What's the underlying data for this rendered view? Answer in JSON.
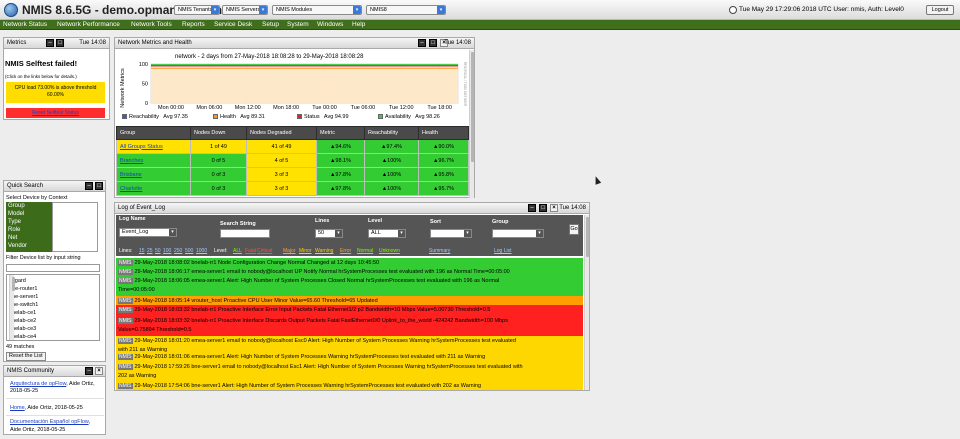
{
  "header": {
    "app_title": "NMIS 8.6.5G - demo.opmantek.com",
    "dropdowns": [
      "NMIS Tenants",
      "NMIS Servers",
      "NMIS Modules",
      "NMIS8"
    ],
    "datetime_user": "Tue May 29 17:29:06 2018 UTC  User: nmis, Auth: Level0",
    "logout": "Logout"
  },
  "menu": [
    "Network Status",
    "Network Performance",
    "Network Tools",
    "Reports",
    "Service Desk",
    "Setup",
    "System",
    "Windows",
    "Help"
  ],
  "metrics_win": {
    "title": "Metrics",
    "time": "Tue 14:08",
    "selftest_title": "NMIS Selftest failed!",
    "click_note": "(Click on the links below for details.)",
    "cpu_line1": "CPU load 73.00% is above threshold",
    "cpu_line2": "60.00%",
    "reset_link": "Reset Selftest Status"
  },
  "health_win": {
    "title": "Network Metrics and Health",
    "time": "Tue 14:08",
    "chart_title": "network - 2 days from 27-May-2018 18:08:28 to 29-May-2018 18:08:28",
    "legend": [
      {
        "name": "Reachability",
        "avg": "Avg 97.35"
      },
      {
        "name": "Health",
        "avg": "Avg 89.31"
      },
      {
        "name": "Status",
        "avg": "Avg 94.99"
      },
      {
        "name": "Availability",
        "avg": "Avg 98.26"
      }
    ],
    "table": {
      "headers": [
        "Group",
        "Nodes Down",
        "Nodes Degraded",
        "Metric",
        "Reachability",
        "Health"
      ],
      "rows": [
        [
          "All Groups Status",
          "1 of 49",
          "41 of 49",
          "▲94.6%",
          "▲97.4%",
          "▲90.0%"
        ],
        [
          "Branches",
          "0 of 5",
          "4 of 5",
          "▲98.1%",
          "▲100%",
          "▲96.7%"
        ],
        [
          "Brisbane",
          "0 of 3",
          "3 of 3",
          "▲97.8%",
          "▲100%",
          "▲95.8%"
        ],
        [
          "Charlotte",
          "0 of 3",
          "3 of 3",
          "▲97.8%",
          "▲100%",
          "▲95.7%"
        ]
      ]
    }
  },
  "chart_data": {
    "type": "area",
    "title": "network - 2 days from 27-May-2018 18:08:28 to 29-May-2018 18:08:28",
    "ylabel": "Network Metrics",
    "ylim": [
      0,
      100
    ],
    "yticks": [
      "100",
      "50",
      "0"
    ],
    "xticks": [
      "Mon 00:00",
      "Mon 06:00",
      "Mon 12:00",
      "Mon 18:00",
      "Tue 00:00",
      "Tue 06:00",
      "Tue 12:00",
      "Tue 18:00"
    ],
    "side_label": "RRDTOOL / TOBI OETIKER",
    "series": [
      {
        "name": "Reachability",
        "color": "#3b5bd6",
        "values": [
          97.4,
          97.4
        ]
      },
      {
        "name": "Health",
        "color": "#f59a2b",
        "values": [
          89.3,
          89.3
        ]
      },
      {
        "name": "Status",
        "color": "#d42a2a",
        "values": [
          95.0,
          95.0
        ]
      },
      {
        "name": "Availability",
        "color": "#3ccf3c",
        "values": [
          98.3,
          98.3
        ]
      }
    ],
    "legend": "bottom"
  },
  "quick_search": {
    "title": "Quick Search",
    "context_label": "Select Device by Context",
    "contexts": [
      "Group",
      "Model",
      "Type",
      "Role",
      "Net",
      "Vendor"
    ],
    "filter_label": "Filter Device list by input string",
    "devices": [
      "asgard",
      "bne-router1",
      "bne-server1",
      "bne-switch1",
      "bnelab-ce1",
      "bnelab-ce2",
      "bnelab-ce3",
      "bnelab-ce4"
    ],
    "matches": "49 matches",
    "reset": "Reset the List"
  },
  "community": {
    "title": "NMIS Community",
    "items": [
      {
        "link": "Arquitectura de opFlow",
        "rest": ", Aide Ortiz,",
        "date": "2018-05-25"
      },
      {
        "link": "Home",
        "rest": ", Aide Ortiz, 2018-05-25",
        "date": ""
      },
      {
        "link": "Documentación Español opFlow",
        "rest": ",",
        "date": "Aide Ortiz, 2018-05-25"
      }
    ]
  },
  "eventlog": {
    "title": "Log of Event_Log",
    "time": "Tue 14:08",
    "labels": {
      "log_name": "Log Name",
      "search": "Search String",
      "lines": "Lines",
      "level": "Level",
      "sort": "Sort",
      "group": "Group"
    },
    "log_name_value": "Event_Log",
    "lines_value": "50",
    "level_value": "ALL",
    "go": "Go",
    "lines_label": "Lines:",
    "line_options": [
      "15",
      "25",
      "50",
      "100",
      "250",
      "500",
      "1000"
    ],
    "level_label": "Level:",
    "level_options": [
      "ALL",
      "Fatal",
      "Critical",
      "Major",
      "Minor",
      "Warning",
      "Error",
      "Normal",
      "Unknown"
    ],
    "summary": "Summary",
    "log_list": "Log List",
    "rows": [
      {
        "color": "#33cc33",
        "badge": "NMIS",
        "text": "29-May-2018 18:08:02  bnelab-rr1  Node Configuration Change  Normal  Changed at 12 days 10:45:50",
        "text2": ""
      },
      {
        "color": "#33cc33",
        "badge": "NMIS",
        "text": "29-May-2018 18:06:17  emea-server1  email to nobody@localhost UP Notify  Normal  hrSystemProcesses test evaluated with 196 as Normal Time=00:05:00",
        "text2": ""
      },
      {
        "color": "#33cc33",
        "badge": "NMIS",
        "text": "29-May-2018 18:06:05  emea-server1  Alert: High Number of System Processes Closed  Normal  hrSystemProcesses test evaluated with 196 as Normal",
        "text2": "Time=00:05:00"
      },
      {
        "color": "#ffa000",
        "badge": "NMIS",
        "text": "29-May-2018 18:05:14  vrouter_host  Proactive CPU User  Minor  Value=65.60 Threshold=65 Updated",
        "text2": ""
      },
      {
        "color": "#ff2020",
        "badge": "NMIS",
        "text": "29-May-2018 18:03:32  bnelab-rr1  Proactive Interface Error Input Packets  Fatal  Ethernet1/2 p2 Bandwidth=10 Mbps Value=5.00730 Threshold=0.5",
        "text2": ""
      },
      {
        "color": "#ff2020",
        "badge": "NMIS",
        "text": "29-May-2018 18:03:32  bnelab-rr1  Proactive Interface Discards Output Packets  Fatal  FastEthernet0/0 Uplink_to_the_world -424242  Bandwidth=100 Mbps",
        "text2": "Value=0.75894 Threshold=0.5"
      },
      {
        "color": "#ffd700",
        "badge": "NMIS",
        "text": "29-May-2018 18:01:20  emea-server1  email to nobody@localhost Esc0 Alert: High Number of System Processes  Warning  hrSystemProcesses test evaluated",
        "text2": "with 211 as Warning"
      },
      {
        "color": "#ffd700",
        "badge": "NMIS",
        "text": "29-May-2018 18:01:06  emea-server1  Alert: High Number of System Processes  Warning  hrSystemProcesses test evaluated with 211 as Warning",
        "text2": ""
      },
      {
        "color": "#ffd700",
        "badge": "NMIS",
        "text": "29-May-2018 17:59:26  bne-server1  email to nobody@localhost Esc1 Alert: High Number of System Processes  Warning  hrSystemProcesses test evaluated with",
        "text2": "202 as Warning"
      },
      {
        "color": "#ffd700",
        "badge": "NMIS",
        "text": "29-May-2018 17:54:06  bne-server1  Alert: High Number of System Processes  Warning  hrSystemProcesses test evaluated with 202 as Warning",
        "text2": ""
      }
    ]
  }
}
